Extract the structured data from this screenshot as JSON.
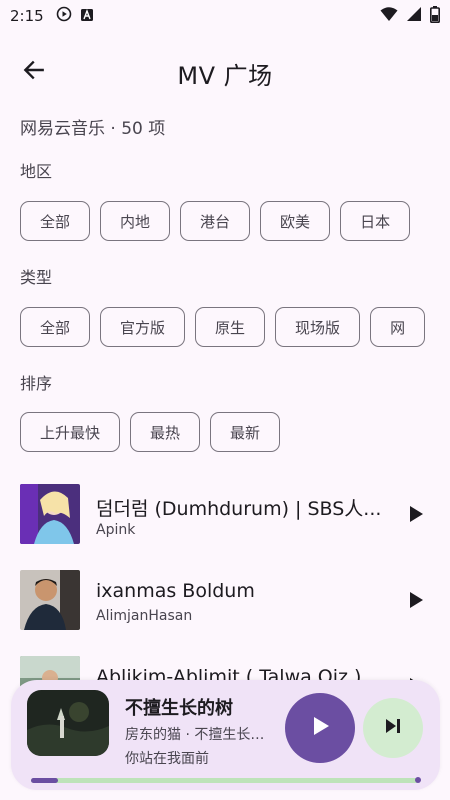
{
  "status_bar": {
    "time": "2:15",
    "left_icons": [
      "play-circle-icon",
      "font-a-icon"
    ],
    "right_icons": [
      "wifi-icon",
      "signal-icon",
      "battery-icon"
    ]
  },
  "app_bar": {
    "title": "MV 广场",
    "back_icon": "arrow-left-icon"
  },
  "source_line": "网易云音乐 · 50 项",
  "filters": {
    "region": {
      "label": "地区",
      "options": [
        "全部",
        "内地",
        "港台",
        "欧美",
        "日本"
      ]
    },
    "type": {
      "label": "类型",
      "options": [
        "全部",
        "官方版",
        "原生",
        "现场版",
        "网"
      ]
    },
    "sort": {
      "label": "排序",
      "options": [
        "上升最快",
        "最热",
        "最新"
      ]
    }
  },
  "mv_list": [
    {
      "title": "덤더럼 (Dumhdurum) | SBS人...",
      "artist": "Apink"
    },
    {
      "title": "ixanmas Boldum",
      "artist": "AlimjanHasan"
    },
    {
      "title": "Ablikim-Ablimit ( Talwa Qiz )",
      "artist": ""
    }
  ],
  "mini_player": {
    "title": "不擅生长的树",
    "subtitle": "房东的猫 · 不擅生长的树",
    "lyric": "你站在我面前",
    "progress": 0.07,
    "colors": {
      "container": "#f0e3f7",
      "play_button": "#6b4ea2",
      "next_button": "#d3ecd0",
      "track": "#bde3b9"
    }
  },
  "colors": {
    "background": "#fdf7fd",
    "chip_border": "#7a757f"
  }
}
